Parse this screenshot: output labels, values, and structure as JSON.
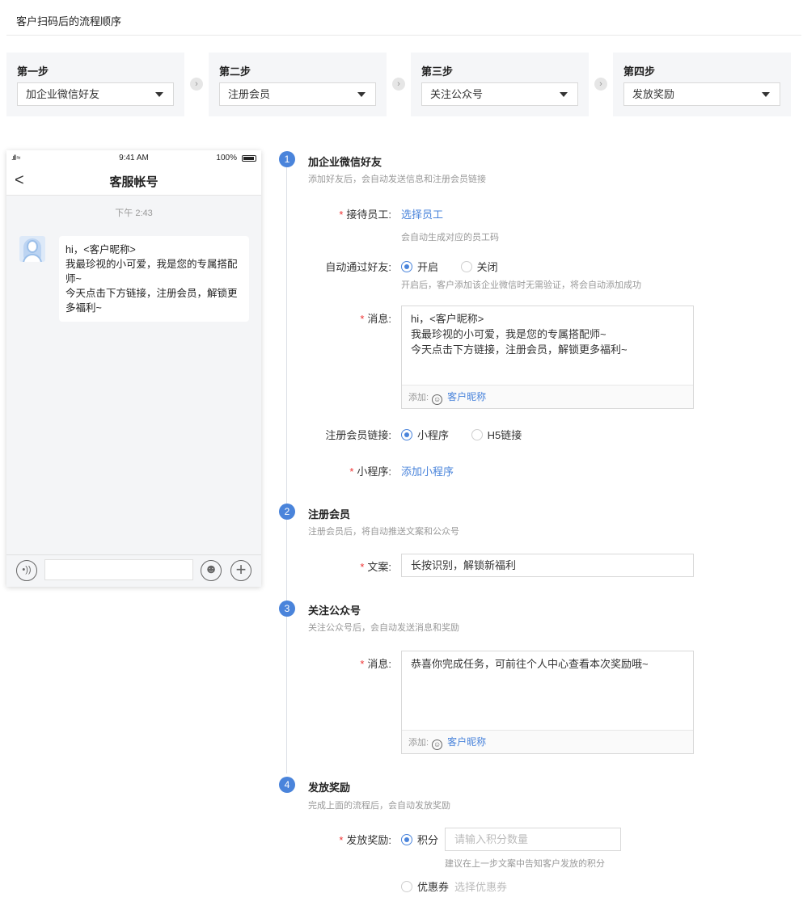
{
  "page_title": "客户扫码后的流程顺序",
  "steps": [
    {
      "label": "第一步",
      "value": "加企业微信好友"
    },
    {
      "label": "第二步",
      "value": "注册会员"
    },
    {
      "label": "第三步",
      "value": "关注公众号"
    },
    {
      "label": "第四步",
      "value": "发放奖励"
    }
  ],
  "step_arrow": "›",
  "phone": {
    "time": "9:41 AM",
    "battery": "100%",
    "signal": ".ıll ≈",
    "back": "<",
    "title": "客服帐号",
    "chat_time": "下午 2:43",
    "message_lines": [
      "hi，<客户昵称>",
      "我最珍视的小可爱，我是您的专属搭配师~",
      "今天点击下方链接，注册会员，解锁更多福利~"
    ]
  },
  "sections": [
    {
      "num": "1",
      "title": "加企业微信好友",
      "desc": "添加好友后，会自动发送信息和注册会员链接"
    },
    {
      "num": "2",
      "title": "注册会员",
      "desc": "注册会员后，将自动推送文案和公众号"
    },
    {
      "num": "3",
      "title": "关注公众号",
      "desc": "关注公众号后，会自动发送消息和奖励"
    },
    {
      "num": "4",
      "title": "发放奖励",
      "desc": "完成上面的流程后，会自动发放奖励"
    }
  ],
  "form": {
    "staff_label": "接待员工:",
    "staff_link": "选择员工",
    "staff_hint": "会自动生成对应的员工码",
    "auto_pass_label": "自动通过好友:",
    "auto_on": "开启",
    "auto_off": "关闭",
    "auto_hint": "开启后，客户添加该企业微信时无需验证，将会自动添加成功",
    "message_label": "消息:",
    "message1": "hi，<客户昵称>\n我最珍视的小可爱，我是您的专属搭配师~\n今天点击下方链接，注册会员，解锁更多福利~",
    "add_label": "添加:",
    "nickname": "客户昵称",
    "link_label": "注册会员链接:",
    "link_mini": "小程序",
    "link_h5": "H5链接",
    "mini_label": "小程序:",
    "mini_link": "添加小程序",
    "copy_label": "文案:",
    "copy_value": "长按识别，解锁新福利",
    "message2": "恭喜你完成任务，可前往个人中心查看本次奖励哦~",
    "reward_label": "发放奖励:",
    "points": "积分",
    "points_placeholder": "请输入积分数量",
    "points_hint": "建议在上一步文案中告知客户发放的积分",
    "coupon": "优惠券",
    "coupon_link": "选择优惠券"
  }
}
